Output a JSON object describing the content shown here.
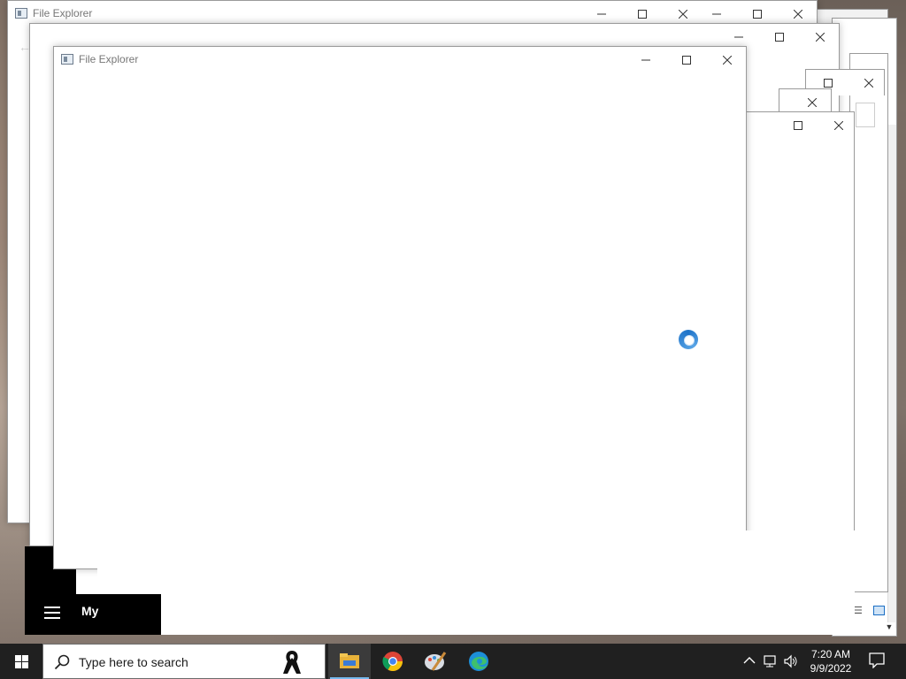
{
  "windows": {
    "back": {
      "title": "File Explorer"
    },
    "front": {
      "title": "File Explorer"
    }
  },
  "taskbar": {
    "search_placeholder": "Type here to search",
    "pinned": [
      {
        "name": "File Explorer",
        "icon": "folder-icon",
        "active": true
      },
      {
        "name": "Google Chrome",
        "icon": "chrome-icon",
        "active": false
      },
      {
        "name": "Paint",
        "icon": "paint-icon",
        "active": false
      },
      {
        "name": "Microsoft Edge",
        "icon": "edge-icon",
        "active": false
      }
    ],
    "clock": {
      "time": "7:20 AM",
      "date": "9/9/2022"
    }
  },
  "start_menu": {
    "partial_text": "My"
  },
  "colors": {
    "taskbar_bg": "#202020",
    "accent": "#76b9ed",
    "spinner": "#1e73c8"
  }
}
